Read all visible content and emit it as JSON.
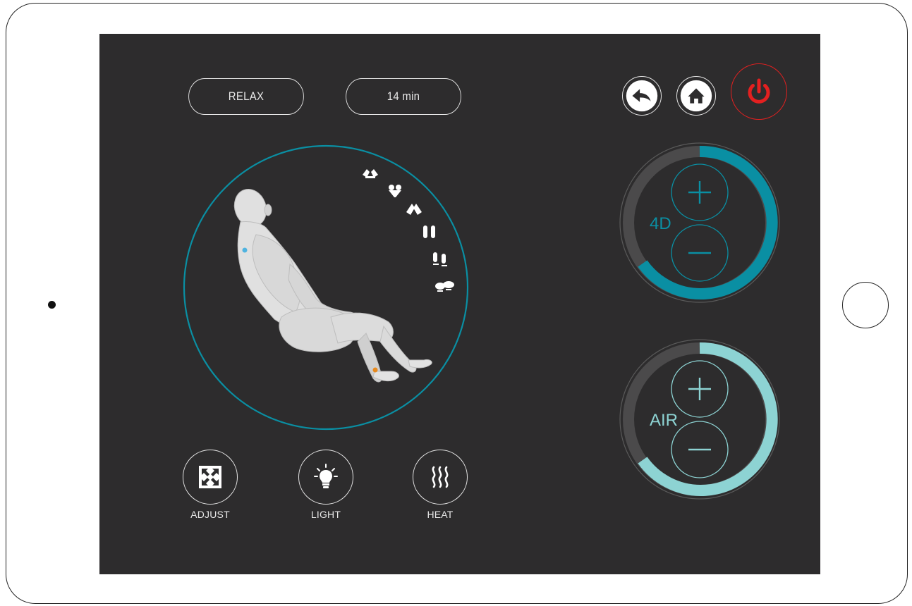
{
  "mode": {
    "label": "RELAX"
  },
  "timer": {
    "label": "14 min"
  },
  "nav": {
    "back_icon": "back-arrow-icon",
    "home_icon": "home-icon",
    "power_icon": "power-icon",
    "power_color": "#e32020"
  },
  "massage_positions": [
    {
      "name": "shoulder-massage-icon"
    },
    {
      "name": "neck-massage-icon"
    },
    {
      "name": "back-massage-icon"
    },
    {
      "name": "arm-massage-icon"
    },
    {
      "name": "calf-massage-icon"
    },
    {
      "name": "foot-massage-icon"
    }
  ],
  "controls": [
    {
      "label": "ADJUST",
      "icon": "adjust-expand-icon"
    },
    {
      "label": "LIGHT",
      "icon": "light-bulb-icon"
    },
    {
      "label": "HEAT",
      "icon": "heat-waves-icon"
    }
  ],
  "dials": {
    "fourd": {
      "label": "4D",
      "color": "#0a8fa3",
      "level": 0.7
    },
    "air": {
      "label": "AIR",
      "color": "#8dd3d3",
      "level": 0.7
    }
  },
  "colors": {
    "screen_bg": "#2d2c2d",
    "accent_teal": "#0a8fa3",
    "accent_light_teal": "#8dd3d3",
    "foreground": "#e8e8e8"
  }
}
